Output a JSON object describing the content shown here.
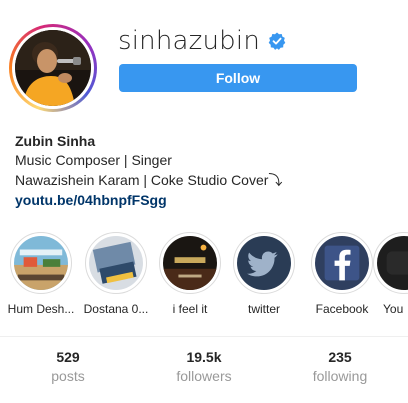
{
  "profile": {
    "username": "sinhazubin",
    "verified_icon": "verified-badge-icon",
    "follow_label": "Follow",
    "display_name": "Zubin Sinha",
    "bio_lines": [
      "Music Composer | Singer",
      "Nawazishein Karam | Coke Studio Cover⤵"
    ],
    "link": "youtu.be/04hbnpfFSgg"
  },
  "highlights": [
    {
      "label": "Hum Desh..."
    },
    {
      "label": "Dostana 0..."
    },
    {
      "label": "i feel it"
    },
    {
      "label": "twitter",
      "icon": "twitter-bird-icon"
    },
    {
      "label": "Facebook",
      "icon": "facebook-f-icon"
    },
    {
      "label": "You"
    }
  ],
  "stats": [
    {
      "value": "529",
      "label": "posts"
    },
    {
      "value": "19.5k",
      "label": "followers"
    },
    {
      "value": "235",
      "label": "following"
    }
  ],
  "colors": {
    "follow_button": "#3897f0",
    "verified": "#3897f0",
    "link": "#003569",
    "muted": "#999999"
  }
}
